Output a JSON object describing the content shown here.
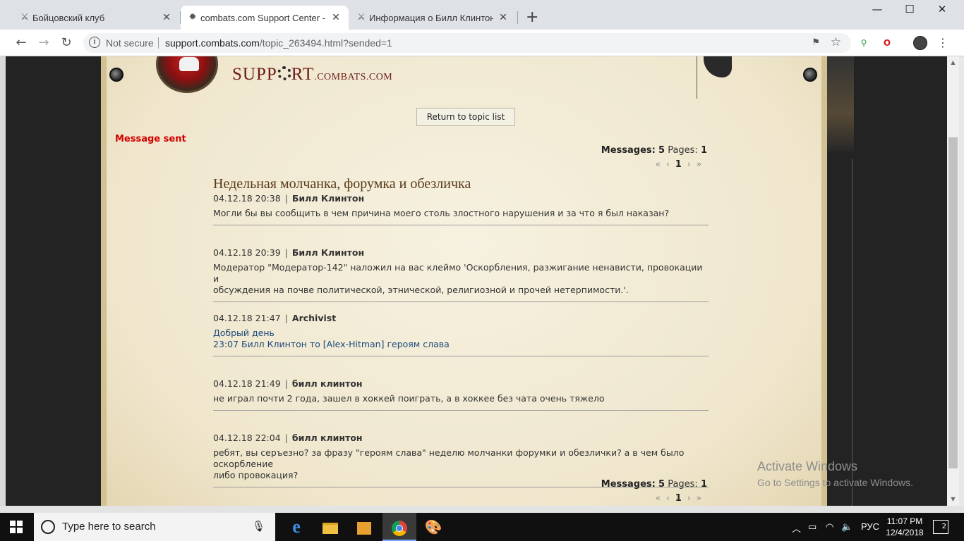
{
  "tabs": [
    {
      "title": "Бойцовский клуб",
      "icon": "swords-icon"
    },
    {
      "title": "combats.com Support Center - s",
      "icon": "gear-icon"
    },
    {
      "title": "Информация о Билл Клинтон",
      "icon": "swords-icon"
    }
  ],
  "address": {
    "security": "Not secure",
    "host": "support.combats.com",
    "path": "/topic_263494.html?sended=1"
  },
  "page": {
    "logo_main": "SUPP",
    "logo_rt": "RT",
    "logo_domain": ".COMBATS.COM",
    "return_button": "Return to topic list",
    "message_sent": "Message sent",
    "messages_label": "Messages:",
    "messages_count": "5",
    "pages_label": "Pages:",
    "pages_count": "1",
    "pager": {
      "first": "«",
      "prev": "‹",
      "current": "1",
      "next": "›",
      "last": "»"
    },
    "topic_title": "Недельная молчанка, форумка и обезличка",
    "posts": [
      {
        "date": "04.12.18 20:38",
        "author": "Билл Клинтон",
        "lines": [
          "Могли бы вы сообщить в чем причина моего столь злостного нарушения и за что я был наказан?"
        ]
      },
      {
        "date": "04.12.18 20:39",
        "author": "Билл Клинтон",
        "lines": [
          "Модератор \"Модератор-142\" наложил на вас клеймо 'Оскорбления, разжигание ненависти, провокации и",
          "обсуждения на почве политической, этнической, религиозной и прочей нетерпимости.'."
        ]
      },
      {
        "date": "04.12.18 21:47",
        "author": "Archivist",
        "lines": [
          "Добрый день",
          "23:07 Билл Клинтон то [Alex-Hitman] героям слава"
        ]
      },
      {
        "date": "04.12.18 21:49",
        "author": "билл клинтон",
        "lines": [
          "не играл почти 2 года, зашел в хоккей поиграть, а в хоккее без чата очень тяжело"
        ]
      },
      {
        "date": "04.12.18 22:04",
        "author": "билл клинтон",
        "lines": [
          "ребят, вы серъезно? за фразу \"героям слава\" неделю молчанки форумки и обезлички? а в чем было оскорбление",
          "либо провокация?"
        ]
      }
    ]
  },
  "watermark": {
    "line1": "Activate Windows",
    "line2": "Go to Settings to activate Windows."
  },
  "taskbar": {
    "search_placeholder": "Type here to search",
    "lang": "РУС",
    "time": "11:07 PM",
    "date": "12/4/2018",
    "notifications": "2"
  }
}
